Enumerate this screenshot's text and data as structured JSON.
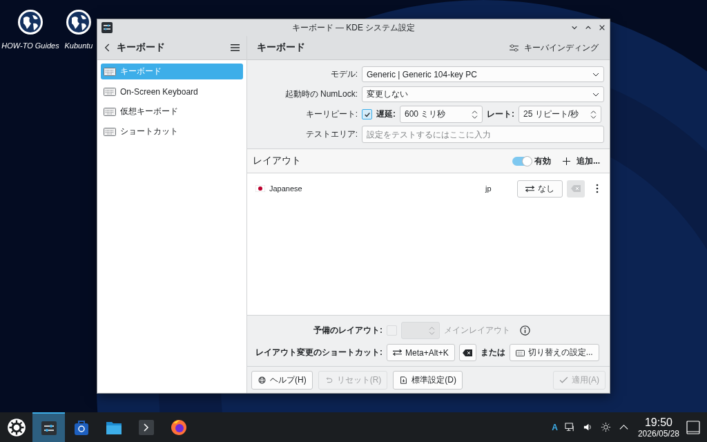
{
  "desktop_icons": [
    {
      "label": "HOW-TO Guides"
    },
    {
      "label": "Kubuntu"
    }
  ],
  "window": {
    "title": "キーボード — KDE システム設定"
  },
  "sidebar": {
    "title": "キーボード",
    "items": [
      {
        "label": "キーボード",
        "selected": true
      },
      {
        "label": "On-Screen Keyboard",
        "selected": false
      },
      {
        "label": "仮想キーボード",
        "selected": false
      },
      {
        "label": "ショートカット",
        "selected": false
      }
    ]
  },
  "page": {
    "title": "キーボード",
    "bindings_button": "キーバインディング"
  },
  "form": {
    "model": {
      "label": "モデル:",
      "value": "Generic | Generic 104-key PC"
    },
    "numlock": {
      "label": "起動時の NumLock:",
      "value": "変更しない"
    },
    "repeat": {
      "label": "キーリピート:",
      "checked": true,
      "delay_label": "遅延:",
      "delay": "600 ミリ秒",
      "rate_label": "レート:",
      "rate": "25 リピート/秒"
    },
    "test": {
      "label": "テストエリア:",
      "placeholder": "設定をテストするにはここに入力"
    }
  },
  "layouts": {
    "title": "レイアウト",
    "enabled": {
      "label": "有効",
      "on": true
    },
    "add_button": "追加...",
    "rows": [
      {
        "name": "Japanese",
        "code": "jp",
        "shortcut": "なし"
      }
    ]
  },
  "spare": {
    "label": "予備のレイアウト:",
    "checked": false,
    "suffix": "メインレイアウト"
  },
  "shortcut": {
    "label": "レイアウト変更のショートカット:",
    "value": "Meta+Alt+K",
    "or": "または",
    "settings_button": "切り替えの設定..."
  },
  "footer": {
    "buttons": [
      {
        "kind": "help",
        "label": "ヘルプ(H)",
        "disabled": false
      },
      {
        "kind": "reset",
        "label": "リセット(R)",
        "disabled": true
      },
      {
        "kind": "defaults",
        "label": "標準設定(D)",
        "disabled": false
      }
    ],
    "apply": {
      "label": "適用(A)",
      "disabled": true
    }
  },
  "taskbar": {
    "apps": [
      {
        "kind": "settings",
        "selected": true
      },
      {
        "kind": "store",
        "selected": false
      },
      {
        "kind": "folder",
        "selected": false
      },
      {
        "kind": "terminal",
        "selected": false
      },
      {
        "kind": "browser",
        "selected": false
      }
    ]
  },
  "tray": {
    "input_method": "A",
    "time": "19:50",
    "date": "2026/05/28"
  }
}
